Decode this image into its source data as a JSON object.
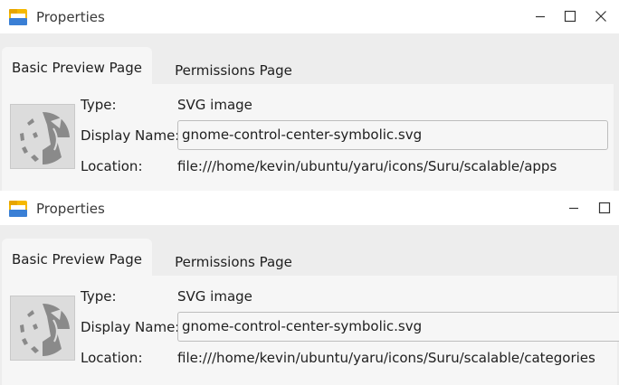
{
  "windows": [
    {
      "title": "Properties",
      "controls": [
        "minimize",
        "maximize",
        "close"
      ],
      "tabs": [
        {
          "label": "Basic Preview Page",
          "active": true
        },
        {
          "label": "Permissions Page",
          "active": false
        }
      ],
      "fields": {
        "type_label": "Type:",
        "type_value": "SVG image",
        "display_name_label": "Display Name:",
        "display_name_value": "gnome-control-center-symbolic.svg",
        "location_label": "Location:",
        "location_value": "file:///home/kevin/ubuntu/yaru/icons/Suru/scalable/apps"
      }
    },
    {
      "title": "Properties",
      "controls": [
        "minimize",
        "maximize"
      ],
      "tabs": [
        {
          "label": "Basic Preview Page",
          "active": true
        },
        {
          "label": "Permissions Page",
          "active": false
        }
      ],
      "fields": {
        "type_label": "Type:",
        "type_value": "SVG image",
        "display_name_label": "Display Name:",
        "display_name_value": "gnome-control-center-symbolic.svg",
        "location_label": "Location:",
        "location_value": "file:///home/kevin/ubuntu/yaru/icons/Suru/scalable/categories"
      }
    }
  ],
  "icons": {
    "app": "folder-icon",
    "minimize": "minimize-icon",
    "maximize": "maximize-icon",
    "close": "close-icon",
    "preview": "gnome-control-center-symbolic-thumbnail"
  },
  "colors": {
    "window_bg": "#ededed",
    "titlebar_bg": "#ffffff",
    "panel_bg": "#f6f6f6",
    "folder_yellow": "#f5b800",
    "folder_blue": "#3a7fd5"
  }
}
